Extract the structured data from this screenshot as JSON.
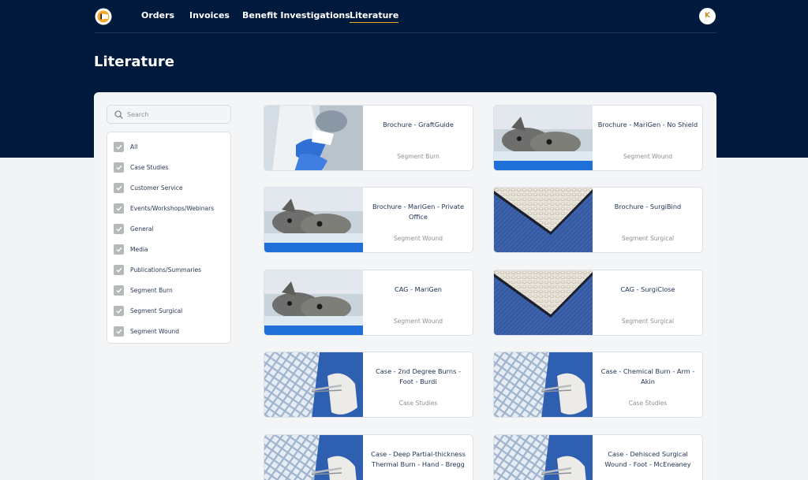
{
  "nav": {
    "links": [
      "Orders",
      "Invoices",
      "Benefit Investigations",
      "Literature"
    ],
    "active": "Literature",
    "avatar_initial": "K"
  },
  "colors": {
    "header_bg": "#001a3d",
    "accent": "#f5a623",
    "checkbox": "#b5bab6"
  },
  "page": {
    "title": "Literature"
  },
  "search": {
    "placeholder": "Search",
    "value": ""
  },
  "filters": {
    "items": [
      "All",
      "Case Studies",
      "Customer Service",
      "Events/Workshops/Webinars",
      "General",
      "Media",
      "Publications/Summaries",
      "Segment Burn",
      "Segment Surgical",
      "Segment Wound"
    ]
  },
  "cards": [
    {
      "title": "Brochure - GraftGuide",
      "category": "Segment Burn",
      "image": "lab-gloves"
    },
    {
      "title": "Brochure - MariGen - No Shield",
      "category": "Segment Wound",
      "image": "fish"
    },
    {
      "title": "Brochure - MariGen - Private Office",
      "category": "Segment Wound",
      "image": "fish"
    },
    {
      "title": "Brochure - SurgiBind",
      "category": "Segment Surgical",
      "image": "mesh-fold"
    },
    {
      "title": "CAG - MariGen",
      "category": "Segment Wound",
      "image": "fish"
    },
    {
      "title": "CAG - SurgiClose",
      "category": "Segment Surgical",
      "image": "mesh-fold"
    },
    {
      "title": "Case - 2nd Degree Burns - Foot - Burdi",
      "category": "Case Studies",
      "image": "mesh-forceps"
    },
    {
      "title": "Case - Chemical Burn - Arm - Akin",
      "category": "Case Studies",
      "image": "mesh-forceps"
    },
    {
      "title": "Case - Deep Partial-thickness Thermal Burn - Hand - Bregg",
      "category": "",
      "image": "mesh-forceps"
    },
    {
      "title": "Case - Dehisced Surgical Wound - Foot - McEneaney",
      "category": "",
      "image": "mesh-forceps"
    }
  ]
}
